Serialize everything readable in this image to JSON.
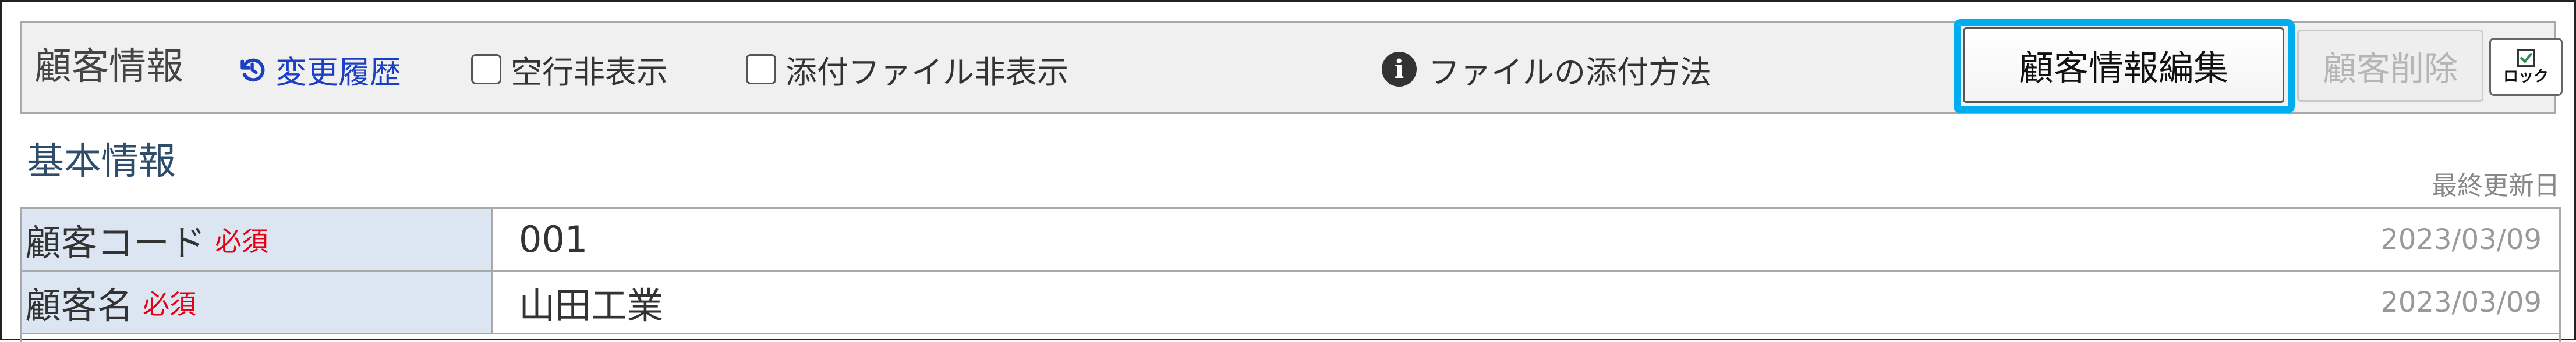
{
  "toolbar": {
    "title": "顧客情報",
    "history_link": "変更履歴",
    "hide_empty_rows": {
      "label": "空行非表示",
      "checked": false
    },
    "hide_attachments": {
      "label": "添付ファイル非表示",
      "checked": false
    },
    "attach_help": "ファイルの添付方法",
    "edit_button": "顧客情報編集",
    "delete_button": "顧客削除",
    "lock_button": "ロック",
    "icons": {
      "history": "history-icon",
      "info": "info-icon",
      "lock": "lock-checkbox-icon"
    }
  },
  "section": {
    "title": "基本情報",
    "updated_header": "最終更新日"
  },
  "fields": [
    {
      "label": "顧客コード",
      "required": "必須",
      "value": "001",
      "updated": "2023/03/09"
    },
    {
      "label": "顧客名",
      "required": "必須",
      "value": "山田工業",
      "updated": "2023/03/09"
    }
  ],
  "colors": {
    "accent_highlight": "#00aeef",
    "link": "#1b3fc6",
    "required": "#e60012",
    "label_bg": "#dce6f2"
  }
}
